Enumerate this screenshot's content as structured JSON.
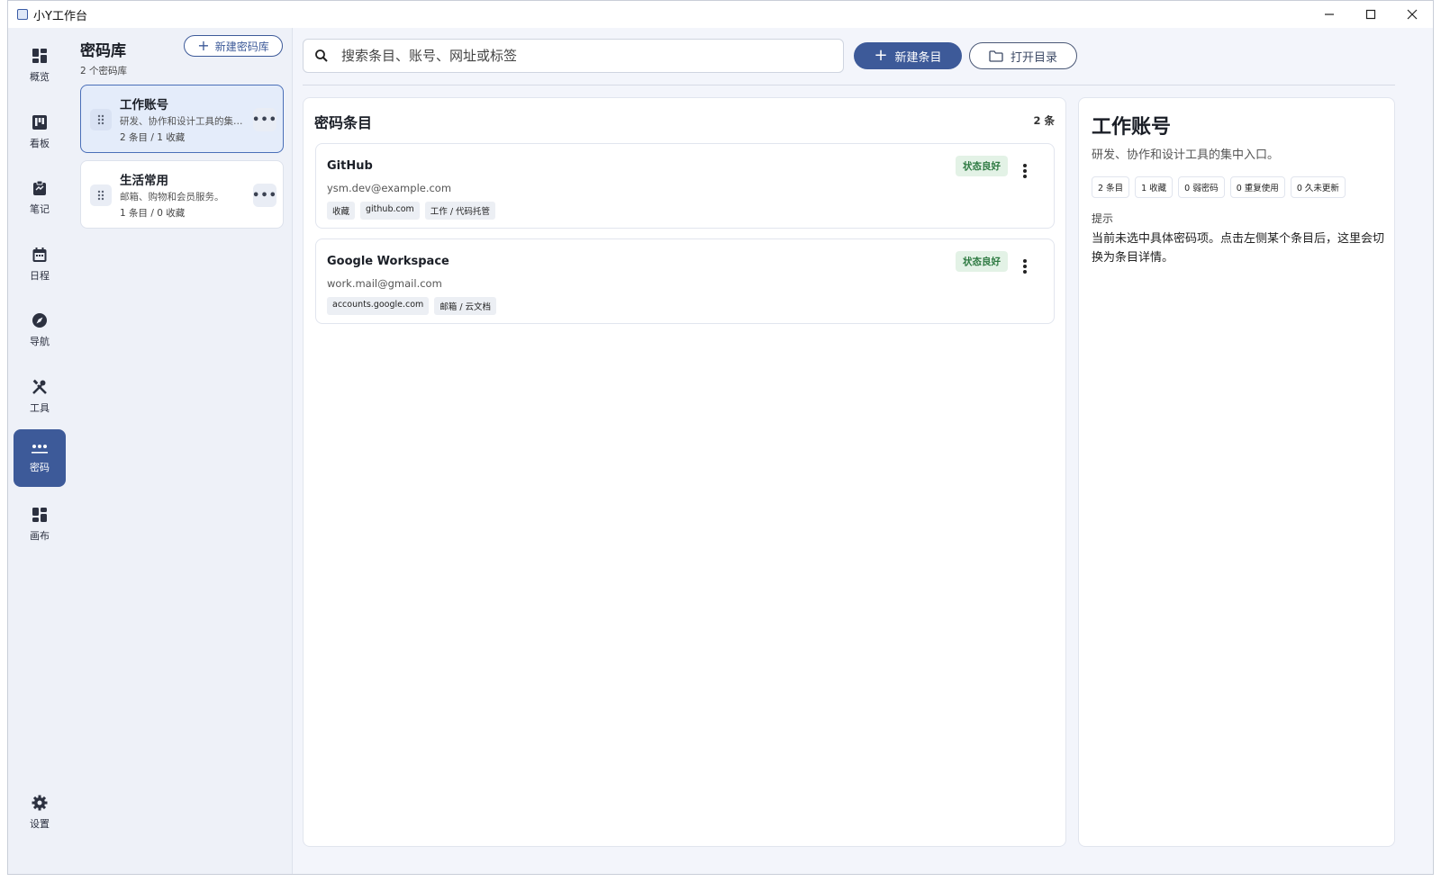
{
  "window": {
    "title": "小Y工作台"
  },
  "rail": {
    "items": [
      {
        "label": "概览",
        "icon": "dashboard-icon"
      },
      {
        "label": "看板",
        "icon": "kanban-icon"
      },
      {
        "label": "笔记",
        "icon": "clipboard-icon"
      },
      {
        "label": "日程",
        "icon": "calendar-icon"
      },
      {
        "label": "导航",
        "icon": "compass-icon"
      },
      {
        "label": "工具",
        "icon": "tools-icon"
      },
      {
        "label": "密码",
        "icon": "password-icon",
        "active": true
      },
      {
        "label": "画布",
        "icon": "canvas-icon"
      }
    ],
    "settings_label": "设置"
  },
  "vaults": {
    "title": "密码库",
    "count": "2 个密码库",
    "new_button": "新建密码库",
    "items": [
      {
        "name": "工作账号",
        "desc": "研发、协作和设计工具的集中入口。",
        "meta": "2 条目 / 1 收藏",
        "selected": true
      },
      {
        "name": "生活常用",
        "desc": "邮箱、购物和会员服务。",
        "meta": "1 条目 / 0 收藏",
        "selected": false
      }
    ]
  },
  "toolbar": {
    "search_placeholder": "搜索条目、账号、网址或标签",
    "new_entry": "新建条目",
    "open_dir": "打开目录"
  },
  "entries": {
    "title": "密码条目",
    "count": "2 条",
    "items": [
      {
        "name": "GitHub",
        "account": "ysm.dev@example.com",
        "status": "状态良好",
        "tags": [
          "收藏",
          "github.com",
          "工作 / 代码托管"
        ]
      },
      {
        "name": "Google Workspace",
        "account": "work.mail@gmail.com",
        "status": "状态良好",
        "tags": [
          "accounts.google.com",
          "邮箱 / 云文档"
        ]
      }
    ]
  },
  "detail": {
    "title": "工作账号",
    "desc": "研发、协作和设计工具的集中入口。",
    "chips": [
      "2 条目",
      "1 收藏",
      "0 弱密码",
      "0 重复使用",
      "0 久未更新"
    ],
    "hint_label": "提示",
    "hint_text": "当前未选中具体密码项。点击左侧某个条目后，这里会切换为条目详情。"
  },
  "colors": {
    "accent": "#3d5a99",
    "status_good": "#2e7a42",
    "status_good_bg": "#e3f2e6"
  }
}
